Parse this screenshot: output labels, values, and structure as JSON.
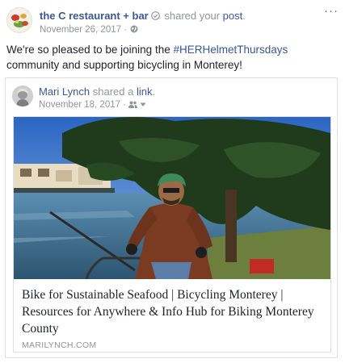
{
  "post": {
    "page_name": "the C restaurant + bar",
    "shared_text": "shared your",
    "shared_object": "post",
    "date": "November 26, 2017",
    "more_label": "···",
    "text_before": "We're so pleased to be joining the ",
    "hashtag": "#HERHelmetThursdays",
    "text_after": " community and supporting bicycling in Monterey!"
  },
  "shared_post": {
    "author": "Mari Lynch",
    "shared_text": "shared a",
    "shared_object": "link",
    "date": "November 18, 2017",
    "privacy_icon": "friends-icon"
  },
  "link_card": {
    "title": "Bike for Sustainable Seafood | Bicycling Monterey | Resources for Anywhere & Info Hub for Biking Monterey County",
    "domain": "MARILYNCH.COM"
  },
  "colors": {
    "link_blue": "#385898",
    "muted_gray": "#90949c",
    "text_dark": "#1d2129",
    "border": "#dddfe2"
  }
}
